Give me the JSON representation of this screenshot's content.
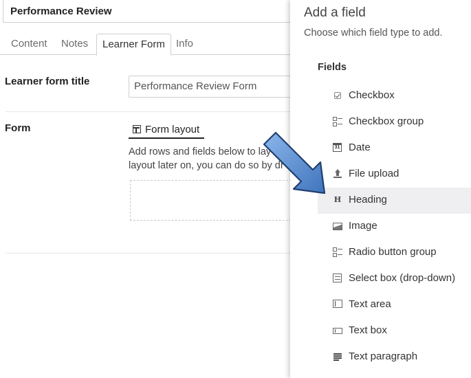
{
  "page": {
    "title_value": "Performance Review",
    "tabs": [
      {
        "label": "Content"
      },
      {
        "label": "Notes"
      },
      {
        "label": "Learner Form"
      },
      {
        "label": "Info"
      }
    ],
    "learner_form_title_label": "Learner form title",
    "learner_form_title_value": "Performance Review Form",
    "form_label": "Form",
    "form_layout_tab": "Form layout",
    "helper_line1": "Add rows and fields below to lay",
    "helper_line2": "layout later on, you can do so by dr"
  },
  "panel": {
    "title": "Add a field",
    "subtitle": "Choose which field type to add.",
    "section": "Fields",
    "fields": [
      {
        "label": "Checkbox",
        "icon": "checkbox-icon"
      },
      {
        "label": "Checkbox group",
        "icon": "checkbox-group-icon"
      },
      {
        "label": "Date",
        "icon": "calendar-icon",
        "icon_text": "31"
      },
      {
        "label": "File upload",
        "icon": "upload-icon"
      },
      {
        "label": "Heading",
        "icon": "heading-icon",
        "icon_text": "H"
      },
      {
        "label": "Image",
        "icon": "image-icon"
      },
      {
        "label": "Radio button group",
        "icon": "radio-group-icon"
      },
      {
        "label": "Select box (drop-down)",
        "icon": "select-box-icon"
      },
      {
        "label": "Text area",
        "icon": "text-area-icon"
      },
      {
        "label": "Text box",
        "icon": "text-box-icon"
      },
      {
        "label": "Text paragraph",
        "icon": "text-paragraph-icon"
      }
    ],
    "hovered_field": "Heading"
  },
  "colors": {
    "panel_hover": "#efeff1",
    "arrow_fill": "#5b8fd0",
    "arrow_stroke": "#1f3f6e"
  }
}
